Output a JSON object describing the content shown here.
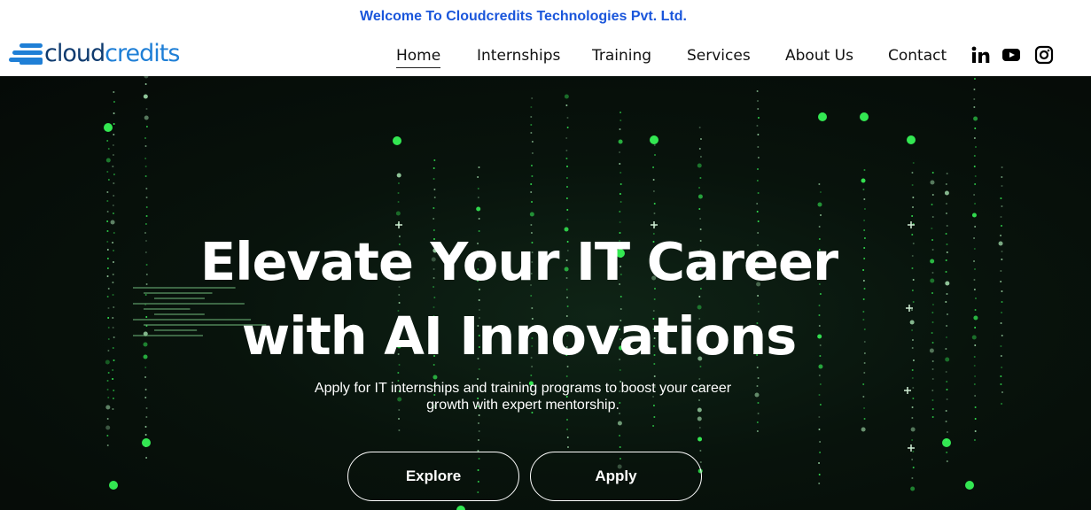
{
  "banner": {
    "text": "Welcome To Cloudcredits Technologies Pvt. Ltd."
  },
  "logo": {
    "part1": "cloud",
    "part2": "credits"
  },
  "nav": {
    "items": [
      {
        "label": "Home",
        "active": true
      },
      {
        "label": "Internships"
      },
      {
        "label": "Training"
      },
      {
        "label": "Services"
      },
      {
        "label": "About Us"
      },
      {
        "label": "Contact"
      }
    ]
  },
  "social": [
    {
      "icon": "linkedin-icon"
    },
    {
      "icon": "youtube-icon"
    },
    {
      "icon": "instagram-icon"
    }
  ],
  "hero": {
    "title_line1": "Elevate Your IT Career",
    "title_line2": "with AI Innovations",
    "subtitle_line1": "Apply for IT internships and training programs to boost your career",
    "subtitle_line2": "growth with expert mentorship.",
    "explore_label": "Explore",
    "apply_label": "Apply"
  },
  "colors": {
    "banner_text": "#1a56db",
    "logo_dark": "#0f3b6f",
    "logo_light": "#1f7fd6",
    "hero_glow": "#39ff5a"
  }
}
